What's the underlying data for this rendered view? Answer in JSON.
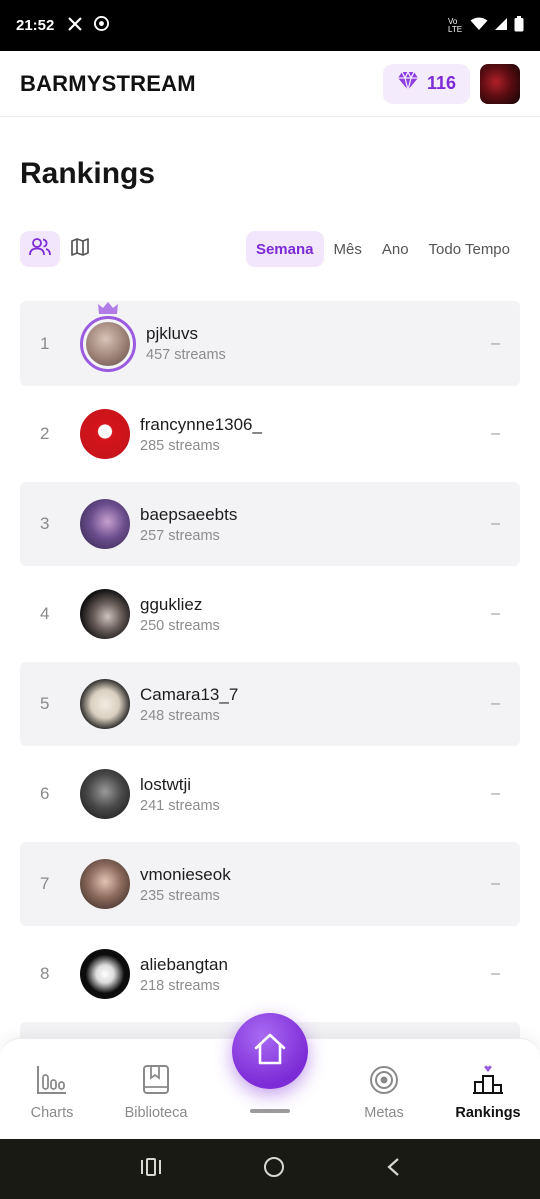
{
  "status_bar": {
    "time": "21:52",
    "network": "Vo LTE"
  },
  "header": {
    "brand": "BARMYSTREAM",
    "gems": "116"
  },
  "page": {
    "title": "Rankings"
  },
  "filters": {
    "views": [
      "users-icon",
      "map-icon"
    ],
    "periods": [
      "Semana",
      "Mês",
      "Ano",
      "Todo Tempo"
    ],
    "active_period": "Semana"
  },
  "rankings": [
    {
      "rank": "1",
      "name": "pjkluvs",
      "streams": "457 streams",
      "trend": "–"
    },
    {
      "rank": "2",
      "name": "francynne1306_",
      "streams": "285 streams",
      "trend": "–"
    },
    {
      "rank": "3",
      "name": "baepsaeebts",
      "streams": "257 streams",
      "trend": "–"
    },
    {
      "rank": "4",
      "name": "ggukliez",
      "streams": "250 streams",
      "trend": "–"
    },
    {
      "rank": "5",
      "name": "Camara13_7",
      "streams": "248 streams",
      "trend": "–"
    },
    {
      "rank": "6",
      "name": "lostwtji",
      "streams": "241 streams",
      "trend": "–"
    },
    {
      "rank": "7",
      "name": "vmonieseok",
      "streams": "235 streams",
      "trend": "–"
    },
    {
      "rank": "8",
      "name": "aliebangtan",
      "streams": "218 streams",
      "trend": "–"
    }
  ],
  "bottom_nav": {
    "charts": "Charts",
    "library": "Biblioteca",
    "goals": "Metas",
    "rankings": "Rankings"
  },
  "colors": {
    "accent": "#7d2bd6",
    "accent_soft": "#f1e6fb"
  }
}
